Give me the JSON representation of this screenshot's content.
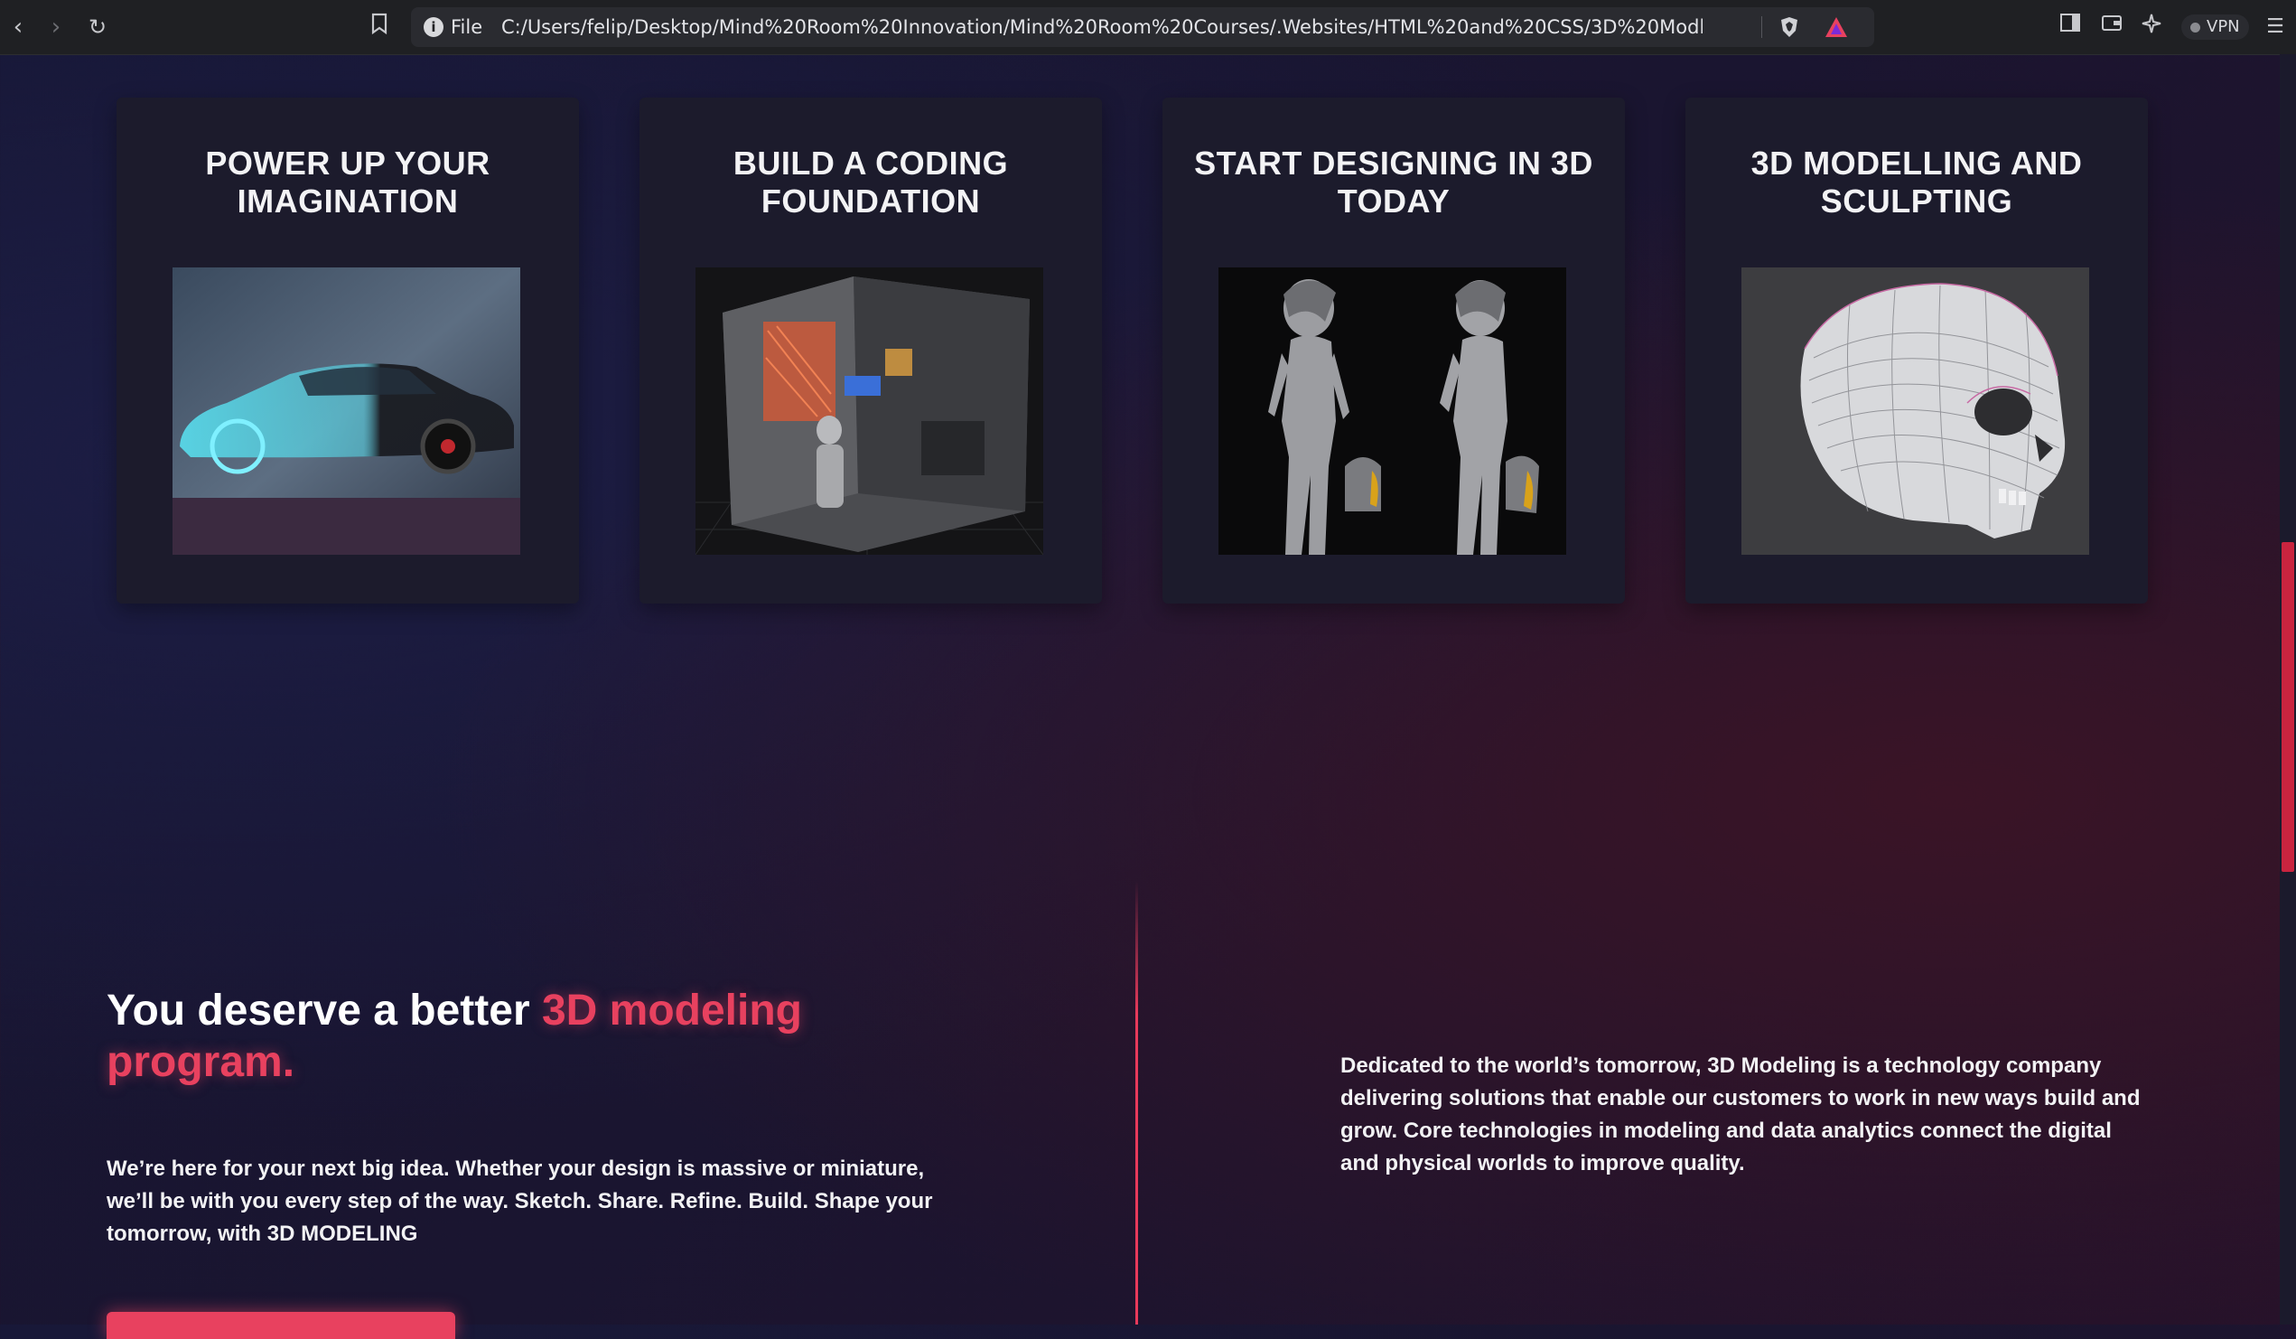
{
  "browser": {
    "file_label": "File",
    "url": "C:/Users/felip/Desktop/Mind%20Room%20Innovation/Mind%20Room%20Courses/.Websites/HTML%20and%20CSS/3D%20Modlling%20website/3...",
    "vpn_label": "VPN"
  },
  "cards": [
    {
      "title": "POWER UP YOUR IMAGINATION",
      "image": "car-xray-render"
    },
    {
      "title": "BUILD A CODING FOUNDATION",
      "image": "room-3d-render"
    },
    {
      "title": "START DESIGNING IN 3D TODAY",
      "image": "character-sculpt-render"
    },
    {
      "title": "3D MODELLING AND SCULPTING",
      "image": "skull-wireframe-render"
    }
  ],
  "intro": {
    "heading_plain": "You deserve a better ",
    "heading_accent": "3D modeling program.",
    "left_paragraph": "We’re here for your next big idea. Whether your design is massive or miniature, we’ll be with you every step of the way. Sketch. Share. Refine. Build. Shape your tomorrow, with 3D MODELING",
    "right_paragraph": "Dedicated to the world’s tomorrow, 3D Modeling is a technology company delivering solutions that enable our customers to work in new ways build and grow. Core technologies in modeling and data analytics connect the digital and physical worlds to improve quality."
  },
  "colors": {
    "accent": "#e8415f",
    "card_bg": "#1c1b2c",
    "page_bg": "#1a1530"
  }
}
